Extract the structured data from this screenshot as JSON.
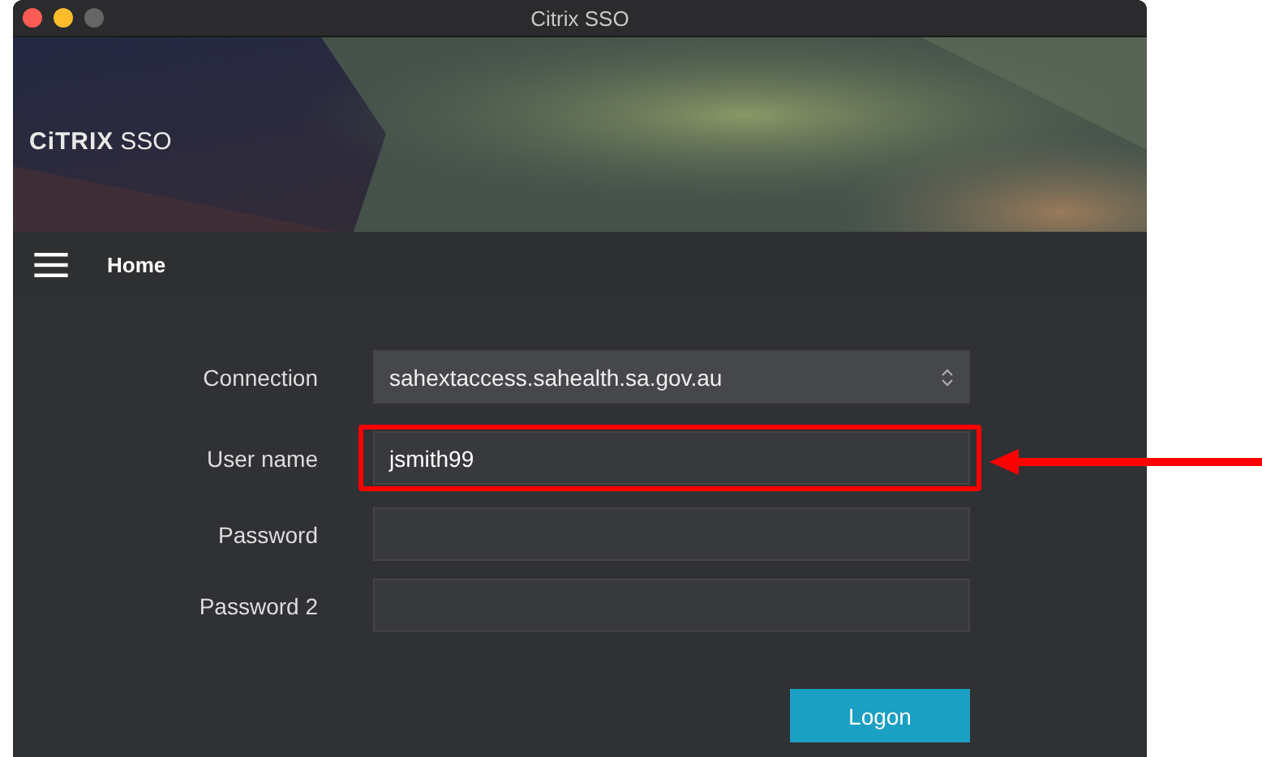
{
  "window": {
    "title": "Citrix SSO"
  },
  "header": {
    "logo": "CiTRIX",
    "product": "SSO"
  },
  "nav": {
    "title": "Home"
  },
  "fields": [
    {
      "label": "Connection",
      "kind": "select",
      "value": "sahextaccess.sahealth.sa.gov.au",
      "highlighted": false
    },
    {
      "label": "User name",
      "kind": "text",
      "value": "jsmith99",
      "highlighted": true
    },
    {
      "label": "Password",
      "kind": "text",
      "highlighted": false
    },
    {
      "label": "Password 2",
      "kind": "text",
      "highlighted": false
    }
  ],
  "buttons": [
    "Logon"
  ]
}
